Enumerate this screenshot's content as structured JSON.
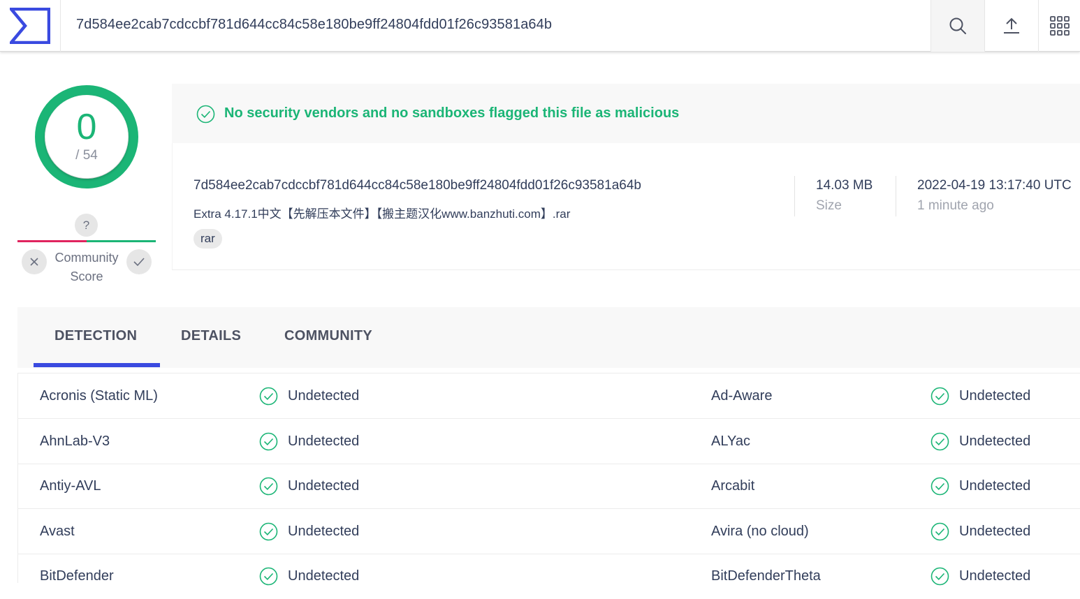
{
  "header": {
    "search_value": "7d584ee2cab7cdccbf781d644cc84c58e180be9ff24804fdd01f26c93581a64b"
  },
  "score": {
    "detections": "0",
    "total": "/ 54",
    "ring_color": "#1bb576"
  },
  "community": {
    "question": "?",
    "label_line1": "Community",
    "label_line2": "Score"
  },
  "banner": {
    "text": "No security vendors and no sandboxes flagged this file as malicious",
    "color": "#1bb576"
  },
  "file": {
    "hash": "7d584ee2cab7cdccbf781d644cc84c58e180be9ff24804fdd01f26c93581a64b",
    "name": "Extra 4.17.1中文【先解压本文件】【搬主题汉化www.banzhuti.com】.rar",
    "tag": "rar",
    "size_value": "14.03 MB",
    "size_label": "Size",
    "date_value": "2022-04-19 13:17:40 UTC",
    "date_label": "1 minute ago"
  },
  "tabs": [
    {
      "label": "DETECTION",
      "active": true
    },
    {
      "label": "DETAILS",
      "active": false
    },
    {
      "label": "COMMUNITY",
      "active": false
    }
  ],
  "detections": [
    {
      "left_vendor": "Acronis (Static ML)",
      "left_result": "Undetected",
      "right_vendor": "Ad-Aware",
      "right_result": "Undetected"
    },
    {
      "left_vendor": "AhnLab-V3",
      "left_result": "Undetected",
      "right_vendor": "ALYac",
      "right_result": "Undetected"
    },
    {
      "left_vendor": "Antiy-AVL",
      "left_result": "Undetected",
      "right_vendor": "Arcabit",
      "right_result": "Undetected"
    },
    {
      "left_vendor": "Avast",
      "left_result": "Undetected",
      "right_vendor": "Avira (no cloud)",
      "right_result": "Undetected"
    },
    {
      "left_vendor": "BitDefender",
      "left_result": "Undetected",
      "right_vendor": "BitDefenderTheta",
      "right_result": "Undetected"
    }
  ],
  "colors": {
    "accent_blue": "#3a4ae0",
    "clean_green": "#1bb576",
    "negative_red": "#e0245e"
  }
}
